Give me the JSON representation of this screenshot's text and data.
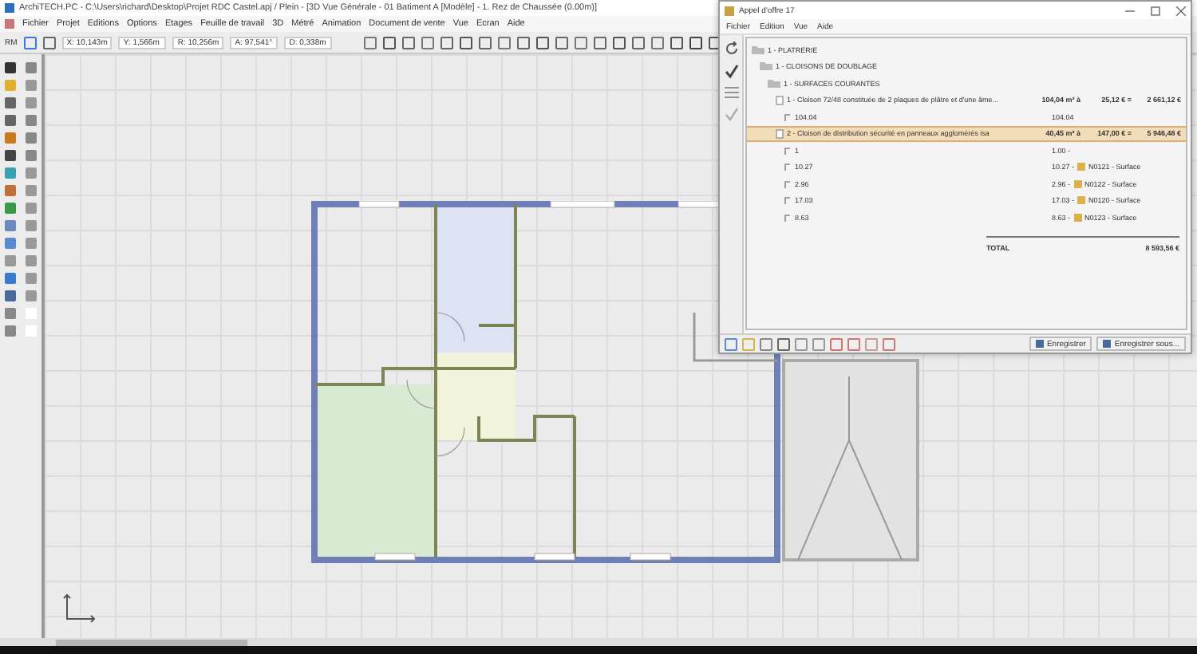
{
  "window": {
    "title": "ArchiTECH.PC - C:\\Users\\richard\\Desktop\\Projet RDC Castel.apj / Plein - [3D Vue Générale - 01 Batiment A [Modèle] - 1. Rez de Chaussée (0.00m)]"
  },
  "menu": [
    "Fichier",
    "Projet",
    "Editions",
    "Options",
    "Etages",
    "Feuille de travail",
    "3D",
    "Métré",
    "Animation",
    "Document de vente",
    "Vue",
    "Ecran",
    "Aide"
  ],
  "toolbar": {
    "mode": "RM",
    "coordinates": [
      "X: 10,143m",
      "Y: 1,566m",
      "R: 10,256m",
      "A: 97,541°",
      "D: 0,338m"
    ]
  },
  "quote_window": {
    "title": "Appel d'offre 17",
    "menu": [
      "Fichier",
      "Edition",
      "Vue",
      "Aide"
    ],
    "rows": [
      {
        "kind": "folder",
        "label": "1 - PLATRERIE",
        "children": [
          {
            "kind": "folder",
            "label": "1 - CLOISONS DE DOUBLAGE",
            "children": [
              {
                "kind": "folder",
                "label": "1 - SURFACES COURANTES",
                "children": [
                  {
                    "kind": "item",
                    "label": "1 - Cloison 72/48 constituée de 2 plaques de plâtre et d'une âme...",
                    "quantity": "104,04 m² à",
                    "price": "25,12 € =",
                    "amount": "2 661,12 €",
                    "selected": false,
                    "children": [
                      {
                        "kind": "measure",
                        "label": "104.04",
                        "value": "104.04"
                      }
                    ]
                  },
                  {
                    "kind": "item",
                    "label": "2 - Cloison de distribution sécurité en panneaux agglomérés isa",
                    "quantity": "40,45 m² à",
                    "price": "147,00 € =",
                    "amount": "5 946,48 €",
                    "selected": true,
                    "children": [
                      {
                        "kind": "measure",
                        "label": "1",
                        "value": "1.00 -"
                      },
                      {
                        "kind": "measure",
                        "label": "10.27",
                        "value": "10.27 -",
                        "ref": "N0121 - Surface"
                      },
                      {
                        "kind": "measure",
                        "label": "2.96",
                        "value": "2.96 -",
                        "ref": "N0122 - Surface"
                      },
                      {
                        "kind": "measure",
                        "label": "17.03",
                        "value": "17.03 -",
                        "ref": "N0120 - Surface"
                      },
                      {
                        "kind": "measure",
                        "label": "8.63",
                        "value": "8.63 -",
                        "ref": "N0123 - Surface"
                      }
                    ]
                  }
                ]
              }
            ]
          }
        ]
      }
    ],
    "total": {
      "label": "TOTAL",
      "value": "8 593,56 €"
    },
    "buttons": [
      "Enregistrer",
      "Enregistrer sous..."
    ]
  }
}
